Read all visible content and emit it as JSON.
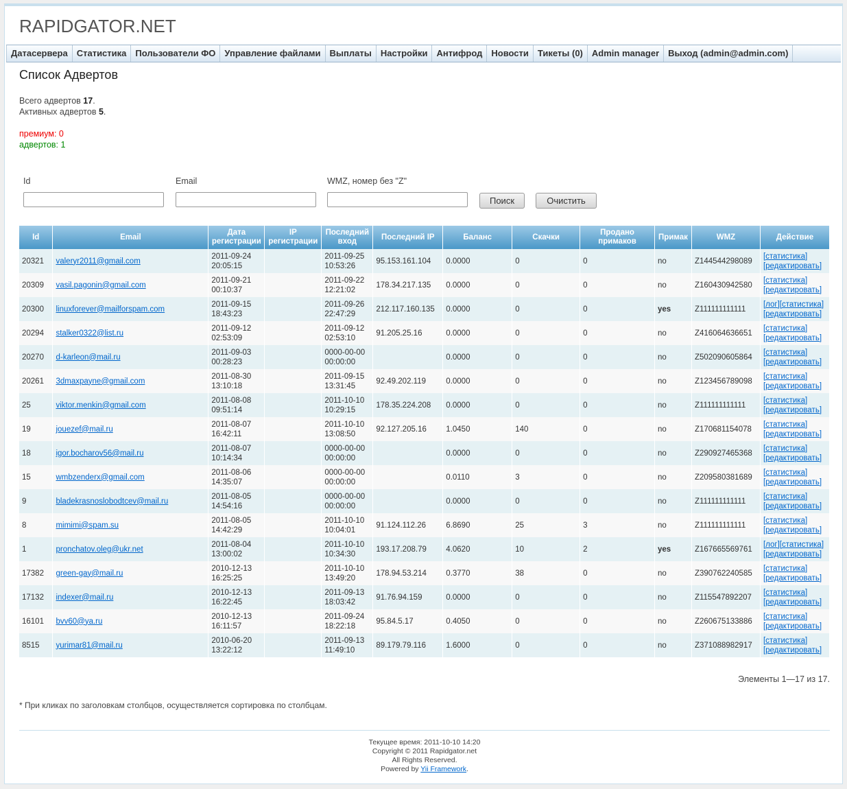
{
  "site": {
    "logo": "RAPIDGATOR.NET"
  },
  "menu": [
    {
      "label": "Датасервера"
    },
    {
      "label": "Статистика"
    },
    {
      "label": "Пользователи ФО"
    },
    {
      "label": "Управление файлами"
    },
    {
      "label": "Выплаты"
    },
    {
      "label": "Настройки"
    },
    {
      "label": "Антифрод"
    },
    {
      "label": "Новости"
    },
    {
      "label": "Тикеты (0)"
    },
    {
      "label": "Admin manager"
    },
    {
      "label": "Выход (admin@admin.com)"
    }
  ],
  "page": {
    "title": "Список Адвертов",
    "total_label": "Всего адвертов",
    "total_value": "17",
    "active_label": "Активных адвертов",
    "active_value": "5",
    "premium_line": "премиум: 0",
    "adverts_line": "адвертов: 1"
  },
  "filter": {
    "id_label": "Id",
    "id_value": "",
    "email_label": "Email",
    "email_value": "",
    "wmz_label": "WMZ, номер без \"Z\"",
    "wmz_value": "",
    "search_button": "Поиск",
    "clear_button": "Очистить"
  },
  "table": {
    "headers": [
      "Id",
      "Email",
      "Дата регистрации",
      "IP регистрации",
      "Последний вход",
      "Последний IP",
      "Баланс",
      "Скачки",
      "Продано примаков",
      "Примак",
      "WMZ",
      "Действие"
    ],
    "action_log": "[лог]",
    "action_stats": "[статистика]",
    "action_edit": "[редактировать]",
    "rows": [
      {
        "id": "20321",
        "email": "valeryr2011@gmail.com",
        "reg_date": "2011-09-24",
        "reg_time": "20:05:15",
        "reg_ip": "",
        "last_date": "2011-09-25",
        "last_time": "10:53:26",
        "last_ip": "95.153.161.104",
        "balance": "0.0000",
        "downloads": "0",
        "sold": "0",
        "primak": "no",
        "wmz": "Z144544298089",
        "log": false
      },
      {
        "id": "20309",
        "email": "vasil.pagonin@gmail.com",
        "reg_date": "2011-09-21",
        "reg_time": "00:10:37",
        "reg_ip": "",
        "last_date": "2011-09-22",
        "last_time": "12:21:02",
        "last_ip": "178.34.217.135",
        "balance": "0.0000",
        "downloads": "0",
        "sold": "0",
        "primak": "no",
        "wmz": "Z160430942580",
        "log": false
      },
      {
        "id": "20300",
        "email": "linuxforever@mailforspam.com",
        "reg_date": "2011-09-15",
        "reg_time": "18:43:23",
        "reg_ip": "",
        "last_date": "2011-09-26",
        "last_time": "22:47:29",
        "last_ip": "212.117.160.135",
        "balance": "0.0000",
        "downloads": "0",
        "sold": "0",
        "primak": "yes",
        "wmz": "Z111111111111",
        "log": true
      },
      {
        "id": "20294",
        "email": "stalker0322@list.ru",
        "reg_date": "2011-09-12",
        "reg_time": "02:53:09",
        "reg_ip": "",
        "last_date": "2011-09-12",
        "last_time": "02:53:10",
        "last_ip": "91.205.25.16",
        "balance": "0.0000",
        "downloads": "0",
        "sold": "0",
        "primak": "no",
        "wmz": "Z416064636651",
        "log": false
      },
      {
        "id": "20270",
        "email": "d-karleon@mail.ru",
        "reg_date": "2011-09-03",
        "reg_time": "00:28:23",
        "reg_ip": "",
        "last_date": "0000-00-00",
        "last_time": "00:00:00",
        "last_ip": "",
        "balance": "0.0000",
        "downloads": "0",
        "sold": "0",
        "primak": "no",
        "wmz": "Z502090605864",
        "log": false
      },
      {
        "id": "20261",
        "email": "3dmaxpayne@gmail.com",
        "reg_date": "2011-08-30",
        "reg_time": "13:10:18",
        "reg_ip": "",
        "last_date": "2011-09-15",
        "last_time": "13:31:45",
        "last_ip": "92.49.202.119",
        "balance": "0.0000",
        "downloads": "0",
        "sold": "0",
        "primak": "no",
        "wmz": "Z123456789098",
        "log": false
      },
      {
        "id": "25",
        "email": "viktor.menkin@gmail.com",
        "reg_date": "2011-08-08",
        "reg_time": "09:51:14",
        "reg_ip": "",
        "last_date": "2011-10-10",
        "last_time": "10:29:15",
        "last_ip": "178.35.224.208",
        "balance": "0.0000",
        "downloads": "0",
        "sold": "0",
        "primak": "no",
        "wmz": "Z111111111111",
        "log": false
      },
      {
        "id": "19",
        "email": "jouezef@mail.ru",
        "reg_date": "2011-08-07",
        "reg_time": "16:42:11",
        "reg_ip": "",
        "last_date": "2011-10-10",
        "last_time": "13:08:50",
        "last_ip": "92.127.205.16",
        "balance": "1.0450",
        "downloads": "140",
        "sold": "0",
        "primak": "no",
        "wmz": "Z170681154078",
        "log": false
      },
      {
        "id": "18",
        "email": "igor.bocharov56@mail.ru",
        "reg_date": "2011-08-07",
        "reg_time": "10:14:34",
        "reg_ip": "",
        "last_date": "0000-00-00",
        "last_time": "00:00:00",
        "last_ip": "",
        "balance": "0.0000",
        "downloads": "0",
        "sold": "0",
        "primak": "no",
        "wmz": "Z290927465368",
        "log": false
      },
      {
        "id": "15",
        "email": "wmbzenderx@gmail.com",
        "reg_date": "2011-08-06",
        "reg_time": "14:35:07",
        "reg_ip": "",
        "last_date": "0000-00-00",
        "last_time": "00:00:00",
        "last_ip": "",
        "balance": "0.0110",
        "downloads": "3",
        "sold": "0",
        "primak": "no",
        "wmz": "Z209580381689",
        "log": false
      },
      {
        "id": "9",
        "email": "bladekrasnoslobodtcev@mail.ru",
        "reg_date": "2011-08-05",
        "reg_time": "14:54:16",
        "reg_ip": "",
        "last_date": "0000-00-00",
        "last_time": "00:00:00",
        "last_ip": "",
        "balance": "0.0000",
        "downloads": "0",
        "sold": "0",
        "primak": "no",
        "wmz": "Z111111111111",
        "log": false
      },
      {
        "id": "8",
        "email": "mimimi@spam.su",
        "reg_date": "2011-08-05",
        "reg_time": "14:42:29",
        "reg_ip": "",
        "last_date": "2011-10-10",
        "last_time": "10:04:01",
        "last_ip": "91.124.112.26",
        "balance": "6.8690",
        "downloads": "25",
        "sold": "3",
        "primak": "no",
        "wmz": "Z111111111111",
        "log": false
      },
      {
        "id": "1",
        "email": "pronchatov.oleg@ukr.net",
        "reg_date": "2011-08-04",
        "reg_time": "13:00:02",
        "reg_ip": "",
        "last_date": "2011-10-10",
        "last_time": "10:34:30",
        "last_ip": "193.17.208.79",
        "balance": "4.0620",
        "downloads": "10",
        "sold": "2",
        "primak": "yes",
        "wmz": "Z167665569761",
        "log": true
      },
      {
        "id": "17382",
        "email": "green-gay@mail.ru",
        "reg_date": "2010-12-13",
        "reg_time": "16:25:25",
        "reg_ip": "",
        "last_date": "2011-10-10",
        "last_time": "13:49:20",
        "last_ip": "178.94.53.214",
        "balance": "0.3770",
        "downloads": "38",
        "sold": "0",
        "primak": "no",
        "wmz": "Z390762240585",
        "log": false
      },
      {
        "id": "17132",
        "email": "indexer@mail.ru",
        "reg_date": "2010-12-13",
        "reg_time": "16:22:45",
        "reg_ip": "",
        "last_date": "2011-09-13",
        "last_time": "18:03:42",
        "last_ip": "91.76.94.159",
        "balance": "0.0000",
        "downloads": "0",
        "sold": "0",
        "primak": "no",
        "wmz": "Z115547892207",
        "log": false
      },
      {
        "id": "16101",
        "email": "bvv60@ya.ru",
        "reg_date": "2010-12-13",
        "reg_time": "16:11:57",
        "reg_ip": "",
        "last_date": "2011-09-24",
        "last_time": "18:22:18",
        "last_ip": "95.84.5.17",
        "balance": "0.4050",
        "downloads": "0",
        "sold": "0",
        "primak": "no",
        "wmz": "Z260675133886",
        "log": false
      },
      {
        "id": "8515",
        "email": "yurimar81@mail.ru",
        "reg_date": "2010-06-20",
        "reg_time": "13:22:12",
        "reg_ip": "",
        "last_date": "2011-09-13",
        "last_time": "11:49:10",
        "last_ip": "89.179.79.116",
        "balance": "1.6000",
        "downloads": "0",
        "sold": "0",
        "primak": "no",
        "wmz": "Z371088982917",
        "log": false
      }
    ]
  },
  "summary": "Элементы 1—17 из 17.",
  "note": "* При кликах по заголовкам столбцов, осуществляется сортировка по столбцам.",
  "footer": {
    "time": "Текущее время: 2011-10-10 14:20",
    "copyright": "Copyright © 2011 Rapidgator.net",
    "rights": "All Rights Reserved.",
    "powered_prefix": "Powered by ",
    "powered_link": "Yii Framework",
    "powered_suffix": "."
  },
  "colors": {
    "header_gradient_top": "#9cc9e6",
    "header_gradient_bottom": "#4a98c8",
    "row_odd": "#e5f1f4",
    "row_even": "#f8f8f8",
    "premium": "#ee0000",
    "adverts": "#008800",
    "link": "#0066cc"
  }
}
